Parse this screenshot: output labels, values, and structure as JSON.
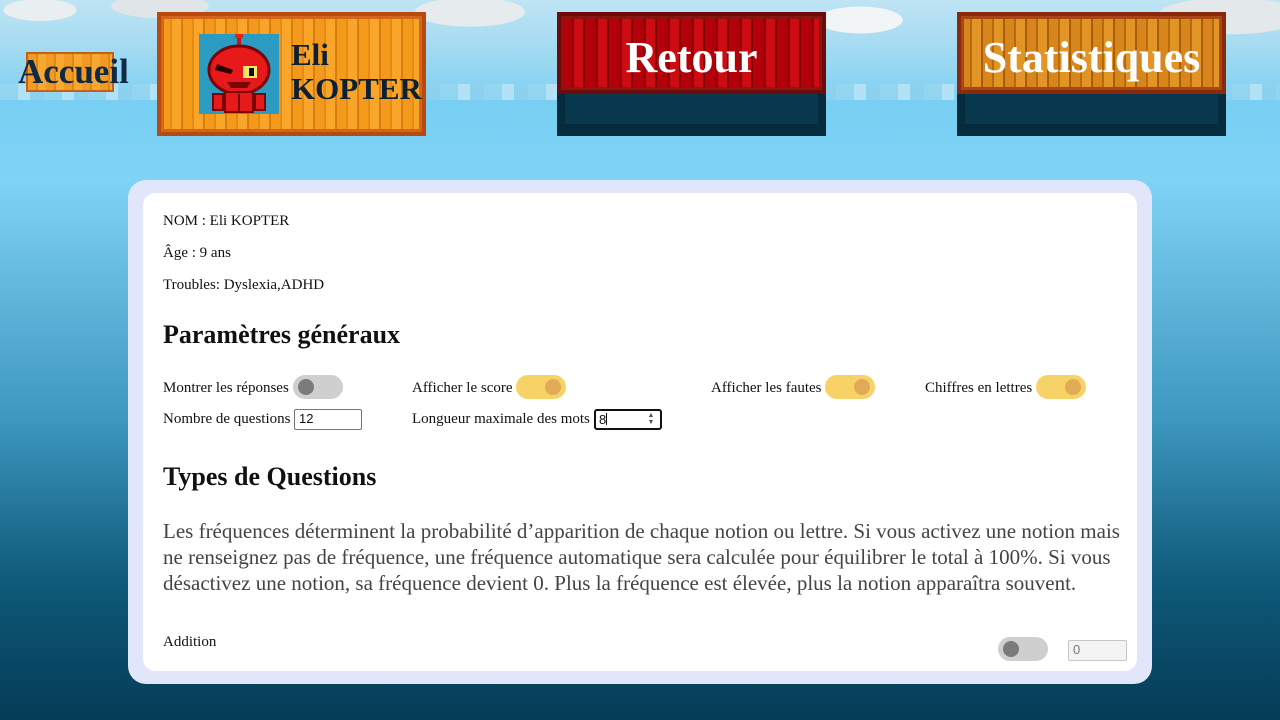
{
  "nav": {
    "home_label": "Accueil",
    "profile_name_line1": "Eli",
    "profile_name_line2": "KOPTER",
    "back_label": "Retour",
    "stats_label": "Statistiques"
  },
  "student": {
    "name_line": "NOM : Eli KOPTER",
    "age_line": "Âge : 9 ans",
    "troubles_line": "Troubles: Dyslexia,ADHD"
  },
  "general": {
    "title": "Paramètres généraux",
    "show_answers_label": "Montrer les réponses",
    "show_answers": false,
    "show_score_label": "Afficher le score",
    "show_score": true,
    "show_errors_label": "Afficher les fautes",
    "show_errors": true,
    "numbers_in_letters_label": "Chiffres en lettres",
    "numbers_in_letters": true,
    "question_count_label": "Nombre de questions",
    "question_count": "12",
    "max_word_length_label": "Longueur maximale des mots",
    "max_word_length": "8"
  },
  "question_types": {
    "title": "Types de Questions",
    "description": "Les fréquences déterminent la probabilité d’apparition de chaque notion ou lettre. Si vous activez une notion mais ne renseignez pas de fréquence, une fréquence automatique sera calculée pour équilibrer le total à 100%. Si vous désactivez une notion, sa fréquence devient 0. Plus la fréquence est élevée, plus la notion apparaîtra souvent.",
    "items": [
      {
        "label": "Addition",
        "enabled": false,
        "frequency": "0"
      }
    ]
  },
  "colors": {
    "toggle_on": "#f7d266",
    "toggle_off": "#cfcfcf",
    "panel_border": "#e1e6fa",
    "back_button": "#b3000a",
    "crate_orange": "#f39a1c"
  },
  "icons": {
    "avatar": "red-robot-avatar-icon"
  }
}
